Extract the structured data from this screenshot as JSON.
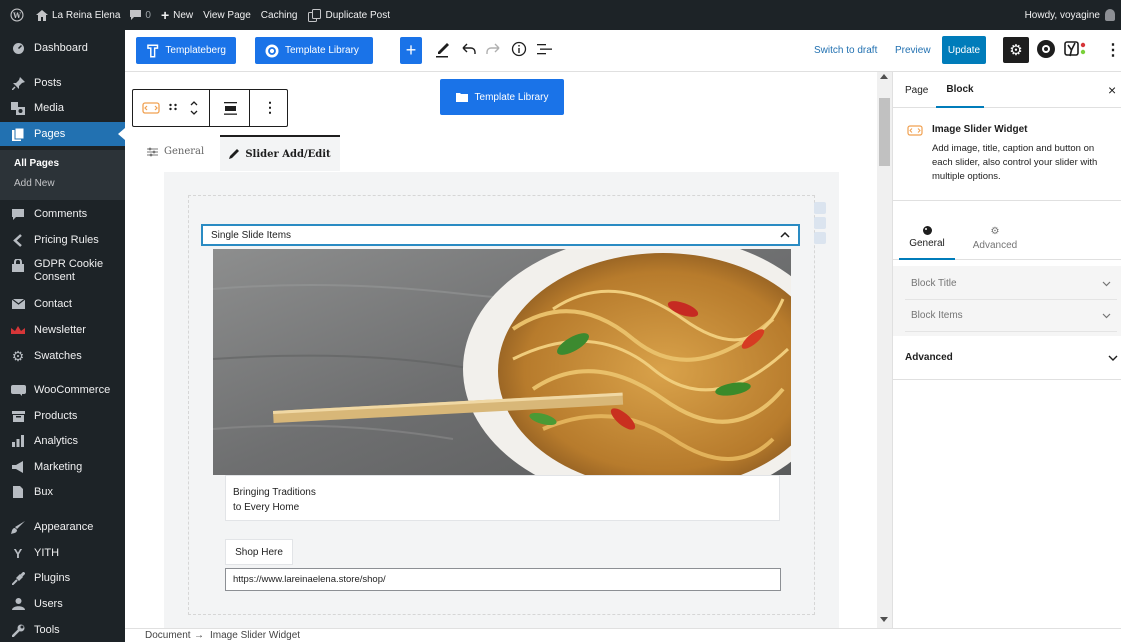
{
  "adminbar": {
    "site_name": "La Reina Elena",
    "comments_count": "0",
    "new_label": "New",
    "view_page": "View Page",
    "caching": "Caching",
    "duplicate_post": "Duplicate Post",
    "howdy": "Howdy, voyagine"
  },
  "sidebar": {
    "items": [
      {
        "label": "Dashboard",
        "icon": "dashboard-icon"
      },
      {
        "label": "Posts",
        "icon": "pin-icon"
      },
      {
        "label": "Media",
        "icon": "media-icon"
      },
      {
        "label": "Pages",
        "icon": "pages-icon"
      },
      {
        "label": "Comments",
        "icon": "comment-icon"
      },
      {
        "label": "Pricing Rules",
        "icon": "chevron-left-icon"
      },
      {
        "label": "GDPR Cookie Consent",
        "icon": "lock-icon"
      },
      {
        "label": "Contact",
        "icon": "mail-icon"
      },
      {
        "label": "Newsletter",
        "icon": "newsletter-icon"
      },
      {
        "label": "Swatches",
        "icon": "gear-icon"
      },
      {
        "label": "WooCommerce",
        "icon": "woo-icon"
      },
      {
        "label": "Products",
        "icon": "archive-icon"
      },
      {
        "label": "Analytics",
        "icon": "bar-chart-icon"
      },
      {
        "label": "Marketing",
        "icon": "megaphone-icon"
      },
      {
        "label": "Bux",
        "icon": "bux-icon"
      },
      {
        "label": "Appearance",
        "icon": "brush-icon"
      },
      {
        "label": "YITH",
        "icon": "yith-icon"
      },
      {
        "label": "Plugins",
        "icon": "plug-icon"
      },
      {
        "label": "Users",
        "icon": "users-icon"
      },
      {
        "label": "Tools",
        "icon": "wrench-icon"
      }
    ],
    "submenu": {
      "all_pages": "All Pages",
      "add_new": "Add New"
    }
  },
  "toolbar": {
    "templateberg": "Templateberg",
    "template_library": "Template Library",
    "switch_to_draft": "Switch to draft",
    "preview": "Preview",
    "update": "Update"
  },
  "editor": {
    "floating_template_library": "Template Library",
    "tabs": {
      "general": "General",
      "slider_add_edit": "Slider Add/Edit"
    },
    "accordion_title": "Single Slide Items",
    "caption_line1": "Bringing Traditions",
    "caption_line2": "to Every Home",
    "button_label": "Shop Here",
    "button_url": "https://www.lareinaelena.store/shop/"
  },
  "panel": {
    "tab_page": "Page",
    "tab_block": "Block",
    "close": "×",
    "block_name": "Image Slider Widget",
    "block_description": "Add image, title, caption and button on each slider, also control your slider with multiple options.",
    "subtab_general": "General",
    "subtab_advanced": "Advanced",
    "section_block_title": "Block Title",
    "section_block_items": "Block Items",
    "section_advanced": "Advanced"
  },
  "footer": {
    "breadcrumb_document": "Document",
    "breadcrumb_arrow": "→",
    "breadcrumb_block": "Image Slider Widget"
  },
  "colors": {
    "admin_dark": "#1d2327",
    "wp_blue": "#2271b1",
    "brand_blue": "#1a73e8",
    "update_blue": "#007cba"
  }
}
